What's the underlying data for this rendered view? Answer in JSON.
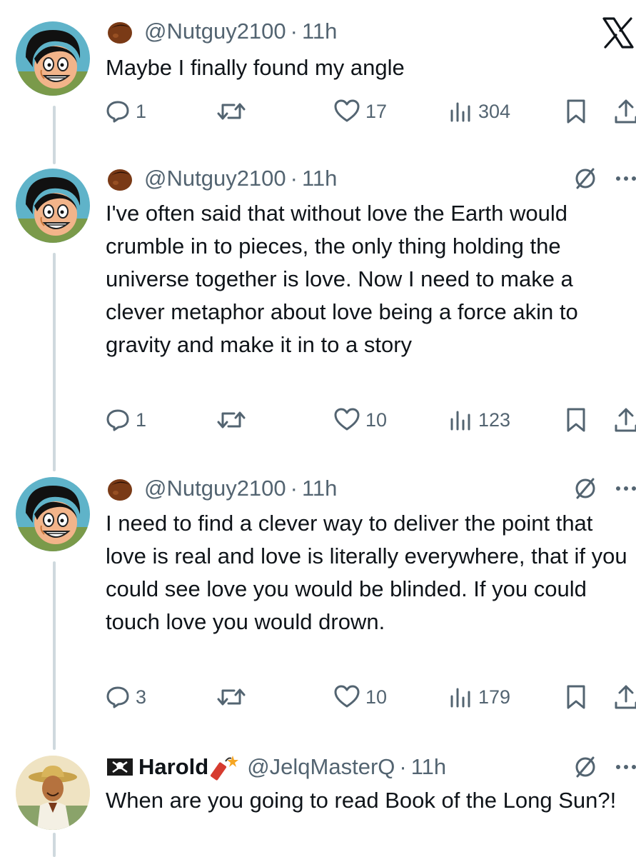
{
  "colors": {
    "text": "#0f1419",
    "muted": "#536471",
    "thread_line": "#cfd9de"
  },
  "tweets": [
    {
      "display_name": "",
      "handle": "@Nutguy2100",
      "time": "11h",
      "text": "Maybe I finally found my angle",
      "replies": "1",
      "retweets": "",
      "likes": "17",
      "views": "304"
    },
    {
      "display_name": "",
      "handle": "@Nutguy2100",
      "time": "11h",
      "text": "I've often said that without love the Earth would crumble in to pieces, the only thing holding the universe together is love. Now I need to make a clever metaphor about love being a force akin to gravity and make it in to a story",
      "replies": "1",
      "retweets": "",
      "likes": "10",
      "views": "123"
    },
    {
      "display_name": "",
      "handle": "@Nutguy2100",
      "time": "11h",
      "text": "I need to find a clever way to deliver the point that love is real and love is literally everywhere, that if you could see love you would be blinded. If you could touch love you would drown.",
      "replies": "3",
      "retweets": "",
      "likes": "10",
      "views": "179"
    },
    {
      "display_name": "Harold",
      "handle": "@JelqMasterQ",
      "time": "11h",
      "text": "When are you going to read Book of the Long Sun?!"
    }
  ],
  "separator": "·",
  "icons": [
    "acorn-badge-icon",
    "x-logo-icon",
    "reply-icon",
    "retweet-icon",
    "like-icon",
    "views-icon",
    "bookmark-icon",
    "share-icon",
    "mute-icon",
    "more-icon",
    "pirate-flag-icon",
    "firecracker-icon"
  ]
}
